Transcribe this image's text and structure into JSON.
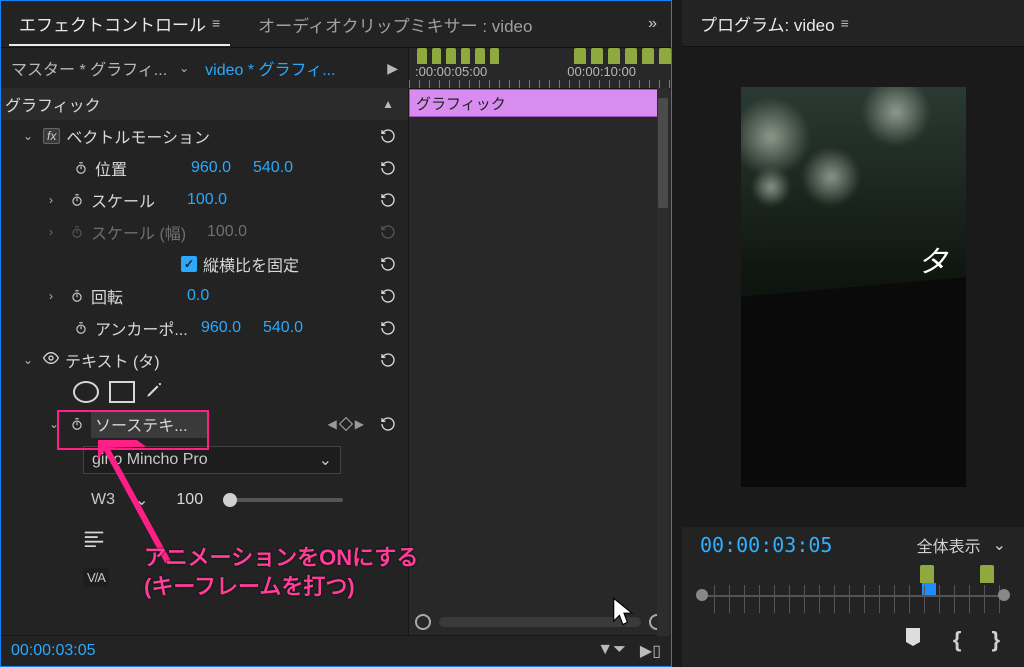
{
  "tabs": {
    "effect_controls": "エフェクトコントロール",
    "audio_mixer": "オーディオクリップミキサー : video",
    "program": "プログラム: video"
  },
  "ec_header": {
    "master": "マスター * グラフィ...",
    "clip": "video * グラフィ..."
  },
  "time_ruler": {
    "t1": ":00:00:05:00",
    "t2": "00:00:10:00"
  },
  "clip_label": "グラフィック",
  "sections": {
    "graphics": "グラフィック",
    "vector_motion": "ベクトルモーション",
    "text_layer": "テキスト (タ)",
    "source_text": "ソーステキ..."
  },
  "props": {
    "position": "位置",
    "position_x": "960.0",
    "position_y": "540.0",
    "scale": "スケール",
    "scale_val": "100.0",
    "scale_w": "スケール (幅)",
    "scale_w_val": "100.0",
    "uniform": "縦横比を固定",
    "rotation": "回転",
    "rotation_val": "0.0",
    "anchor": "アンカーポ...",
    "anchor_x": "960.0",
    "anchor_y": "540.0"
  },
  "font": {
    "family": "gino Mincho Pro",
    "weight": "W3",
    "size": "100"
  },
  "footer_timecode": "00:00:03:05",
  "monitor": {
    "timecode": "00:00:03:05",
    "zoom": "全体表示",
    "overlay_char": "タ"
  },
  "annotation": {
    "line1": "アニメーションをONにする",
    "line2": "(キーフレームを打つ)"
  }
}
